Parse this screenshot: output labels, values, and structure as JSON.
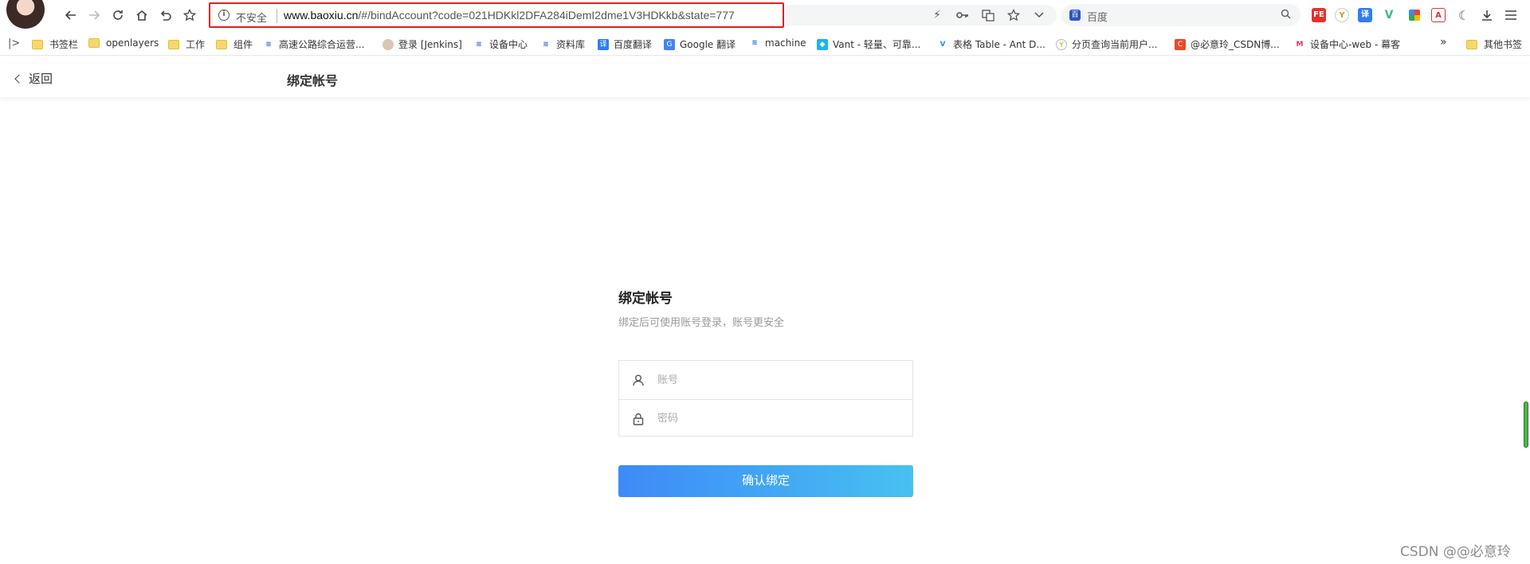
{
  "browser": {
    "address_bar": {
      "security_label": "不安全",
      "url_host": "www.baoxiu.cn",
      "url_path": "/#/bindAccount?code=021HDKkl2DFA284iDemI2dme1V3HDKkb&state=777"
    },
    "search": {
      "engine_label": "百度",
      "placeholder": "百度"
    },
    "icons": [
      "back-icon",
      "forward-icon",
      "reload-icon",
      "home-icon",
      "undo-icon",
      "star-icon"
    ]
  },
  "bookmarks": {
    "items": [
      {
        "label": "书签栏",
        "icon": "folder"
      },
      {
        "label": "openlayers",
        "icon": "folder"
      },
      {
        "label": "工作",
        "icon": "folder"
      },
      {
        "label": "组件",
        "icon": "folder"
      },
      {
        "label": "高速公路综合运营...",
        "icon": "bird"
      },
      {
        "label": "登录 [Jenkins]",
        "icon": "jenkins"
      },
      {
        "label": "设备中心",
        "icon": "bird"
      },
      {
        "label": "资料库",
        "icon": "bird"
      },
      {
        "label": "百度翻译",
        "icon": "baidu-translate"
      },
      {
        "label": "Google 翻译",
        "icon": "google-translate"
      },
      {
        "label": "machine",
        "icon": "bird"
      },
      {
        "label": "Vant - 轻量、可靠...",
        "icon": "vant"
      },
      {
        "label": "表格 Table - Ant D...",
        "icon": "vue"
      },
      {
        "label": "分页查询当前用户...",
        "icon": "yuque"
      },
      {
        "label": "@必意玲_CSDN博...",
        "icon": "csdn"
      },
      {
        "label": "设备中心-web - 幕客",
        "icon": "mail"
      }
    ],
    "more_label": "»",
    "other_label": "其他书签"
  },
  "app": {
    "back_label": "返回",
    "header_title": "绑定帐号",
    "form": {
      "title": "绑定帐号",
      "subtitle": "绑定后可使用账号登录，账号更安全",
      "account_placeholder": "账号",
      "password_placeholder": "密码",
      "submit_label": "确认绑定"
    }
  },
  "watermark": "CSDN @@必意玲",
  "colors": {
    "primary_gradient_start": "#3d8af7",
    "primary_gradient_end": "#47c1f1",
    "address_highlight": "#e02020"
  }
}
